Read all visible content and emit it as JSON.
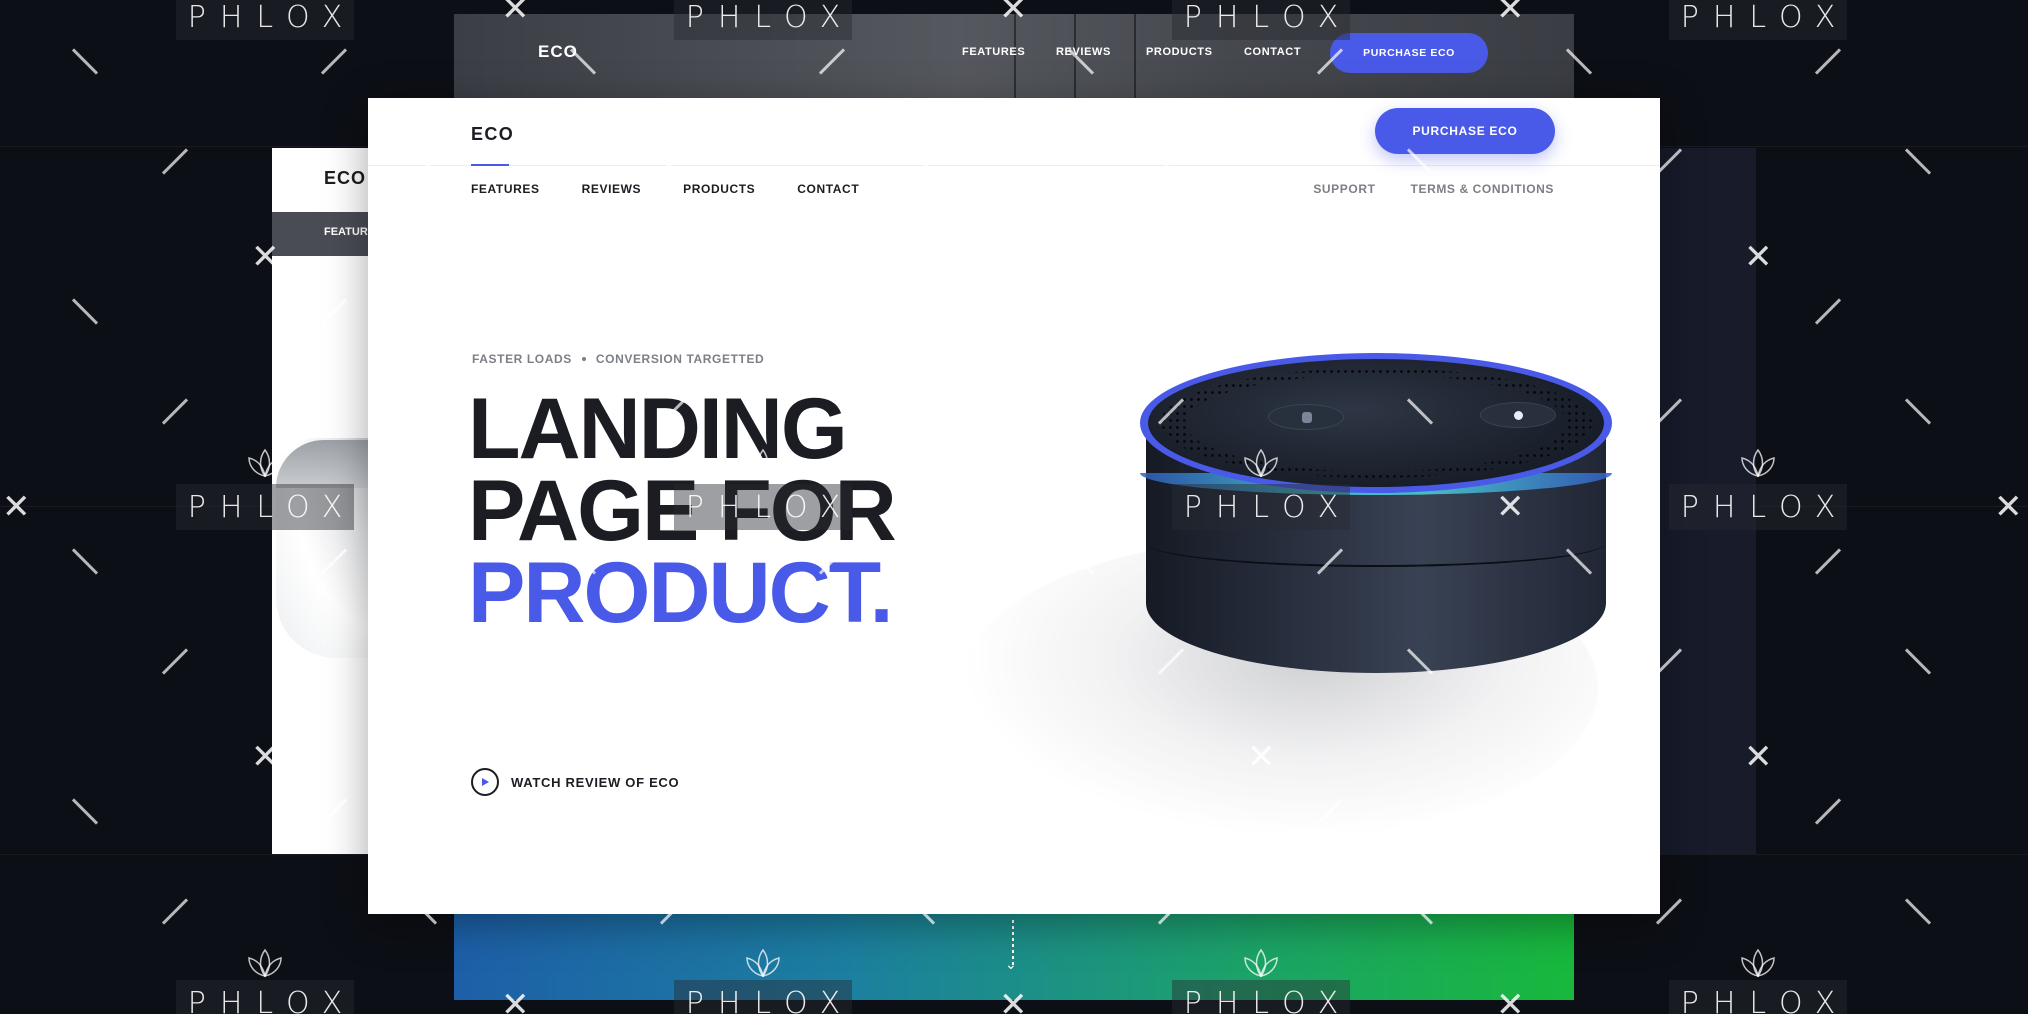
{
  "back_page": {
    "logo": "ECO",
    "nav": [
      "FEATURES",
      "REVIEWS",
      "PRODUCTS",
      "CONTACT"
    ],
    "cta": "PURCHASE ECO"
  },
  "left_page": {
    "logo": "ECO",
    "nav_first": "FEATUR"
  },
  "main_page": {
    "logo": "ECO",
    "cta": "PURCHASE ECO",
    "nav_left": [
      "FEATURES",
      "REVIEWS",
      "PRODUCTS",
      "CONTACT"
    ],
    "nav_right": [
      "SUPPORT",
      "TERMS & CONDITIONS"
    ],
    "kicker": [
      "FASTER LOADS",
      "CONVERSION TARGETTED"
    ],
    "headline": {
      "line1": "LANDING",
      "line2": "PAGE FOR",
      "line3": "PRODUCT."
    },
    "watch_label": "WATCH REVIEW OF ECO",
    "colors": {
      "accent": "#4a5ae8",
      "text": "#1b1d22",
      "muted": "#7c7f86"
    }
  },
  "watermark": {
    "text": "PHLOX"
  }
}
